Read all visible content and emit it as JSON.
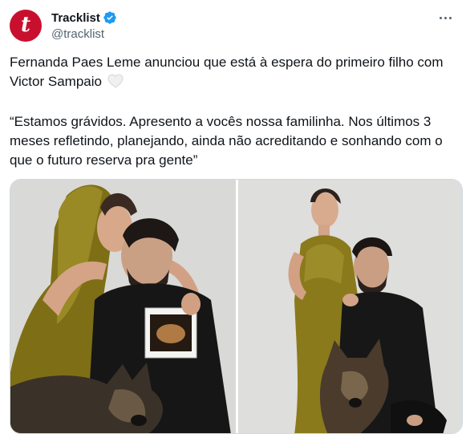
{
  "account": {
    "display_name": "Tracklist",
    "handle": "@tracklist",
    "avatar_letter": "t",
    "avatar_color": "#c8102e",
    "verified": true,
    "verified_color": "#1d9bf0"
  },
  "tweet": {
    "paragraph_1": "Fernanda Paes Leme anunciou que está à espera do primeiro filho com Victor Sampaio",
    "paragraph_1_emoji": "white-heart-icon",
    "paragraph_2": "“Estamos grávidos. Apresento a vocês nossa familinha. Nos últimos 3 meses refletindo, planejando, ainda não acreditando e sonhando com o que o futuro reserva pra gente”"
  },
  "media": {
    "count": 2,
    "photos": [
      {
        "description_icon": "photo-couple-ultrasound"
      },
      {
        "description_icon": "photo-couple-dog-standing"
      }
    ]
  },
  "colors": {
    "text_primary": "#0f1419",
    "text_secondary": "#536471",
    "border": "#cfd9de",
    "olive_dress": "#8a7a1c"
  }
}
